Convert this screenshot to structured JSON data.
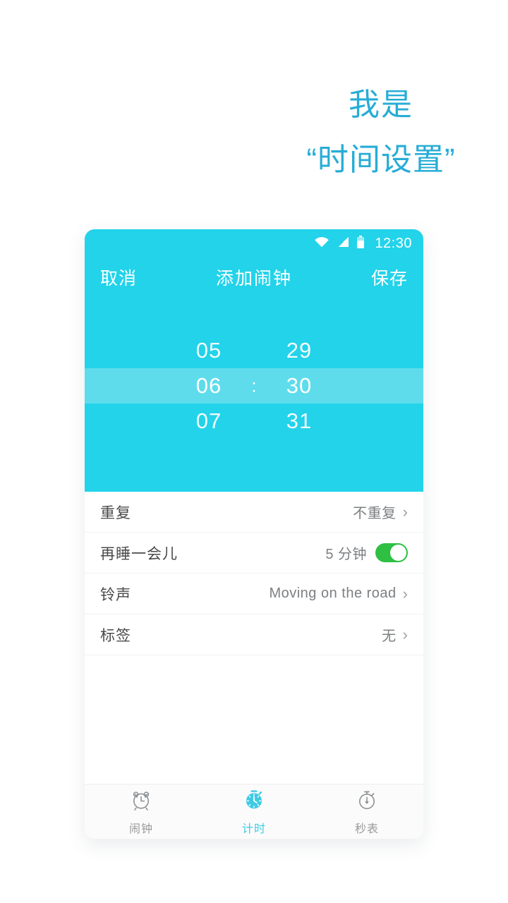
{
  "headline": {
    "line1": "我是",
    "line2": "“时间设置”"
  },
  "colors": {
    "brand_cyan": "#22D3EA",
    "picker_highlight": "#5EDCEC",
    "headline_blue": "#27ADD6",
    "toggle_green": "#2FC043",
    "ribbon_coral": "#F4796A",
    "ribbon_light_blue": "#C8EAF0",
    "tab_active": "#3FCBE4",
    "tab_inactive": "#9A9A9A"
  },
  "phone": {
    "statusbar": {
      "time": "12:30",
      "icons": [
        "wifi-icon",
        "signal-icon",
        "battery-icon"
      ]
    },
    "appbar": {
      "cancel_label": "取消",
      "title": "添加闹钟",
      "save_label": "保存"
    },
    "time_picker": {
      "separator": ":",
      "hour": {
        "prev": "05",
        "current": "06",
        "next": "07"
      },
      "minute": {
        "prev": "29",
        "current": "30",
        "next": "31"
      },
      "selected_time": "06:30"
    },
    "settings_rows": [
      {
        "label": "重复",
        "value": "不重复",
        "control": "chevron",
        "chevron": "›"
      },
      {
        "label": "再睡一会儿",
        "value": "5 分钟",
        "control": "toggle",
        "toggle_on": true
      },
      {
        "label": "铃声",
        "value": "Moving on the road",
        "control": "chevron",
        "chevron": "›"
      },
      {
        "label": "标签",
        "value": "无",
        "control": "chevron",
        "chevron": "›"
      }
    ],
    "tabs": [
      {
        "label": "闹钟",
        "icon": "alarm-clock-icon",
        "active": false
      },
      {
        "label": "计时",
        "icon": "timer-icon",
        "active": true
      },
      {
        "label": "秒表",
        "icon": "stopwatch-icon",
        "active": false
      }
    ]
  }
}
